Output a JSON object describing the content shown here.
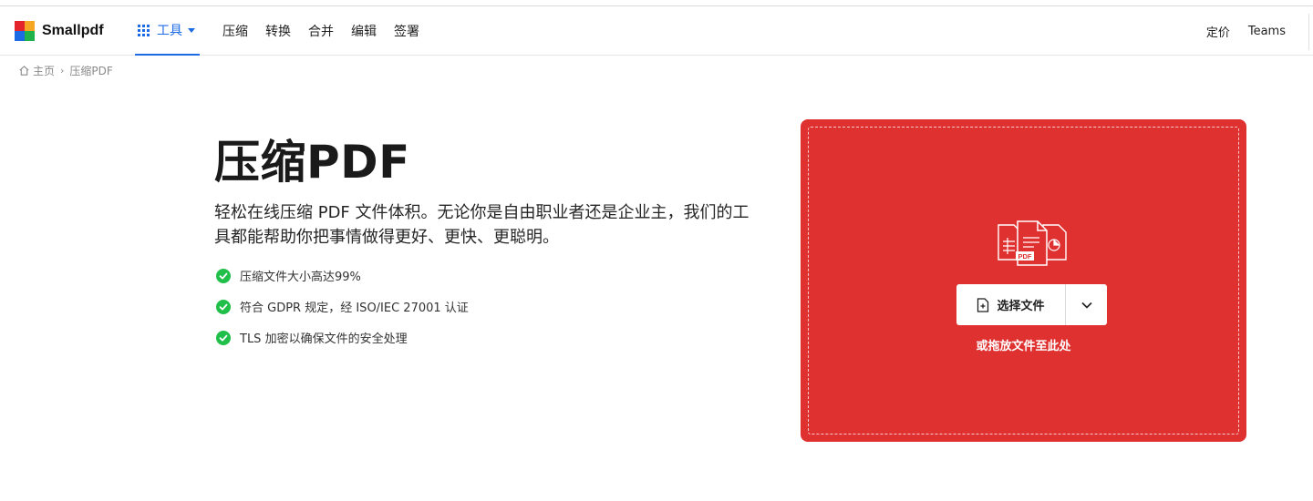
{
  "header": {
    "logo_text": "Smallpdf",
    "logo_colors": [
      "#e4262c",
      "#f5a623",
      "#1d6be4",
      "#20b24b"
    ],
    "tools_label": "工具",
    "nav_items": [
      {
        "label": "压缩"
      },
      {
        "label": "转换"
      },
      {
        "label": "合并"
      },
      {
        "label": "编辑"
      },
      {
        "label": "签署"
      }
    ],
    "pricing_label": "定价",
    "teams_label": "Teams"
  },
  "breadcrumb": {
    "home": "主页",
    "separator": "›",
    "current": "压缩PDF"
  },
  "hero": {
    "title": "压缩PDF",
    "description": "轻松在线压缩 PDF 文件体积。无论你是自由职业者还是企业主，我们的工具都能帮助你把事情做得更好、更快、更聪明。",
    "features": [
      {
        "text": "压缩文件大小高达99%"
      },
      {
        "text": "符合 GDPR 规定，经 ISO/IEC 27001 认证"
      },
      {
        "text": "TLS 加密以确保文件的安全处理"
      }
    ]
  },
  "dropzone": {
    "choose_label": "选择文件",
    "hint": "或拖放文件至此处",
    "pdf_badge": "PDF"
  },
  "colors": {
    "brand_red": "#e03131",
    "accent_blue": "#1d6be4",
    "check_green": "#1fbf4a"
  },
  "icons": {
    "tools": "grid-icon",
    "home": "home-icon",
    "feature": "check-circle-icon",
    "upload": "file-plus-icon",
    "more": "chevron-down-icon"
  }
}
